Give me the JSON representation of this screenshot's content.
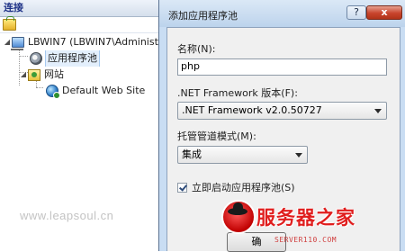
{
  "connections": {
    "header": "连接",
    "tree": {
      "server": "LBWIN7 (LBWIN7\\Administ",
      "app_pools": "应用程序池",
      "sites": "网站",
      "default_site": "Default Web Site"
    }
  },
  "dialog": {
    "title": "添加应用程序池",
    "help_label": "?",
    "close_label": "x",
    "name_label": "名称(N):",
    "name_value": "php",
    "framework_label": ".NET Framework 版本(F):",
    "framework_value": ".NET Framework v2.0.50727",
    "pipeline_label": "托管管道模式(M):",
    "pipeline_value": "集成",
    "autostart_label": "立即启动应用程序池(S)",
    "autostart_checked": true,
    "ok_label": "确"
  },
  "watermarks": {
    "site": "www.leapsoul.cn",
    "brand": "服务器之家",
    "domain": "SERVER110.COM"
  },
  "colors": {
    "accent": "#1e3287",
    "dialog_frame": "#c9ddf3",
    "close_button": "#c8442d",
    "brand_red": "#e01e1e"
  }
}
